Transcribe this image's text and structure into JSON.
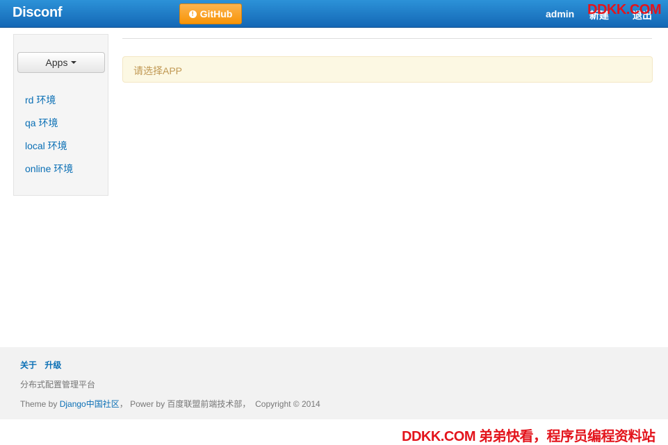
{
  "navbar": {
    "brand": "Disconf",
    "github_label": "GitHub",
    "github_icon": "info-circle-icon",
    "user": "admin",
    "new_label": "新建",
    "logout_label": "退出",
    "bg_color": "#1a76c4"
  },
  "watermark": {
    "top": "DDKK.COM",
    "bottom": "DDKK.COM 弟弟快看，程序员编程资料站",
    "color": "#e3141c"
  },
  "sidebar": {
    "apps_label": "Apps",
    "envs": [
      {
        "label": "rd 环境"
      },
      {
        "label": "qa 环境"
      },
      {
        "label": "local 环境"
      },
      {
        "label": "online 环境"
      }
    ]
  },
  "main": {
    "alert_text": "请选择APP",
    "alert_color": "#fcf8e3"
  },
  "footer": {
    "links": [
      {
        "label": "关于"
      },
      {
        "label": "升级"
      }
    ],
    "description": "分布式配置管理平台",
    "credit_prefix": "Theme by ",
    "credit_link": "Django中国社区",
    "credit_middle": "， Power by 百度联盟前端技术部，",
    "copyright": "Copyright © 2014"
  }
}
